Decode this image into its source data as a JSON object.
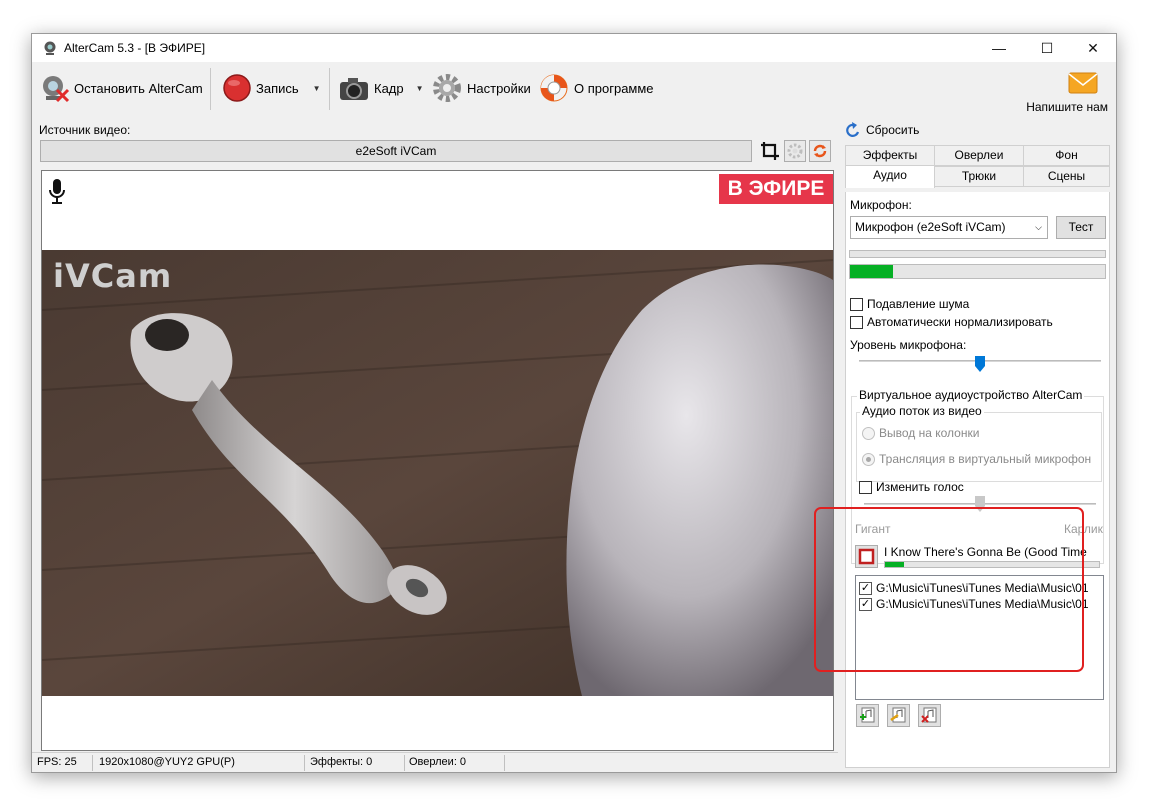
{
  "window": {
    "title": "AlterCam 5.3 - [В ЭФИРЕ]",
    "controls": [
      "—",
      "☐",
      "✕"
    ]
  },
  "toolbar": {
    "stop_label": "Остановить AlterCam",
    "record_label": "Запись",
    "frame_label": "Кадр",
    "settings_label": "Настройки",
    "about_label": "О программе",
    "mail_label": "Напишите нам"
  },
  "source": {
    "label": "Источник видео:",
    "value": "e2eSoft iVCam"
  },
  "preview": {
    "onair_badge": "В ЭФИРЕ",
    "watermark": "iVCam"
  },
  "statusbar": {
    "fps": "FPS: 25",
    "format": "1920x1080@YUY2 GPU(P)",
    "effects": "Эффекты: 0",
    "overlays": "Оверлеи: 0"
  },
  "panel": {
    "reset_label": "Сбросить",
    "tabs_row1": [
      "Эффекты",
      "Оверлеи",
      "Фон"
    ],
    "tabs_row2": [
      "Аудио",
      "Трюки",
      "Сцены"
    ],
    "active_tab": "Аудио",
    "mic_label": "Микрофон:",
    "mic_value": "Микрофон (e2eSoft iVCam)",
    "test_label": "Тест",
    "mic_level_fraction": 0.17,
    "noise_suppression": "Подавление шума",
    "auto_normalize": "Автоматически нормализировать",
    "mic_volume_label": "Уровень микрофона:",
    "mic_volume_fraction": 0.5,
    "virtual_device_title": "Виртуальное аудиоустройство AlterCam",
    "audio_stream_title": "Аудио поток из видео",
    "radio_speakers": "Вывод на колонки",
    "radio_virtual_mic": "Трансляция в виртуальный микрофон",
    "change_voice": "Изменить голос",
    "voice_fraction": 0.5,
    "voice_min": "Гигант",
    "voice_max": "Карлик",
    "player": {
      "track_title": "I Know There's Gonna Be (Good Time",
      "progress_fraction": 0.09,
      "playlist": [
        "G:\\Music\\iTunes\\iTunes Media\\Music\\01",
        "G:\\Music\\iTunes\\iTunes Media\\Music\\01"
      ]
    }
  },
  "colors": {
    "onair": "#e6364a",
    "meter": "#06b025",
    "highlight_box": "#e02020"
  }
}
